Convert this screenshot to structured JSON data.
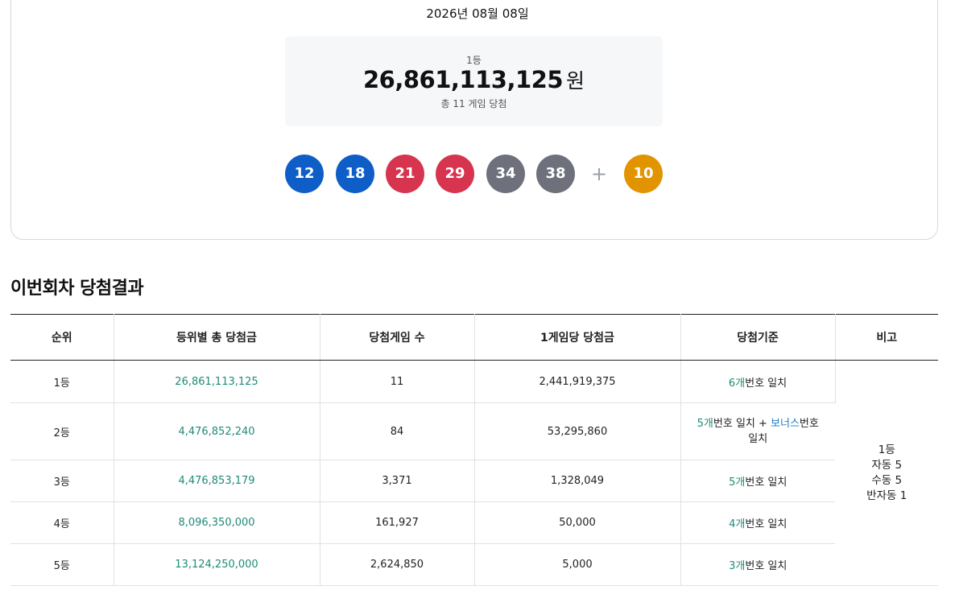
{
  "draw": {
    "date": "2026년 08월 08일",
    "prize_rank": "1등",
    "prize_amount": "26,861,113,125",
    "prize_unit": "원",
    "winners_text": "총 11 게임 당첨"
  },
  "balls": {
    "main": [
      "12",
      "18",
      "21",
      "29",
      "34",
      "38"
    ],
    "plus": "+",
    "bonus": "10",
    "colors": {
      "blue": "#0f5ec7",
      "red": "#d6344f",
      "gray": "#6e717b",
      "yellow": "#e29300"
    }
  },
  "section": {
    "title": "이번회차 당첨결과"
  },
  "table": {
    "headers": [
      "순위",
      "등위별 총 당첨금",
      "당첨게임 수",
      "1게임당 당첨금",
      "당첨기준",
      "비고"
    ],
    "rows": [
      {
        "rank": "1등",
        "total": "26,861,113,125",
        "games": "11",
        "per_game": "2,441,919,375",
        "criteria_count": "6개",
        "criteria_text": "번호 일치"
      },
      {
        "rank": "2등",
        "total": "4,476,852,240",
        "games": "84",
        "per_game": "53,295,860",
        "criteria_count": "5개",
        "criteria_text": "번호 일치 + ",
        "criteria_bonus": "보너스",
        "criteria_tail": "번호 일치"
      },
      {
        "rank": "3등",
        "total": "4,476,853,179",
        "games": "3,371",
        "per_game": "1,328,049",
        "criteria_count": "5개",
        "criteria_text": "번호 일치"
      },
      {
        "rank": "4등",
        "total": "8,096,350,000",
        "games": "161,927",
        "per_game": "50,000",
        "criteria_count": "4개",
        "criteria_text": "번호 일치"
      },
      {
        "rank": "5등",
        "total": "13,124,250,000",
        "games": "2,624,850",
        "per_game": "5,000",
        "criteria_count": "3개",
        "criteria_text": "번호 일치"
      }
    ],
    "note": {
      "line1": "1등",
      "line2": "자동 5",
      "line3": "수동 5",
      "line4": "반자동 1"
    }
  }
}
